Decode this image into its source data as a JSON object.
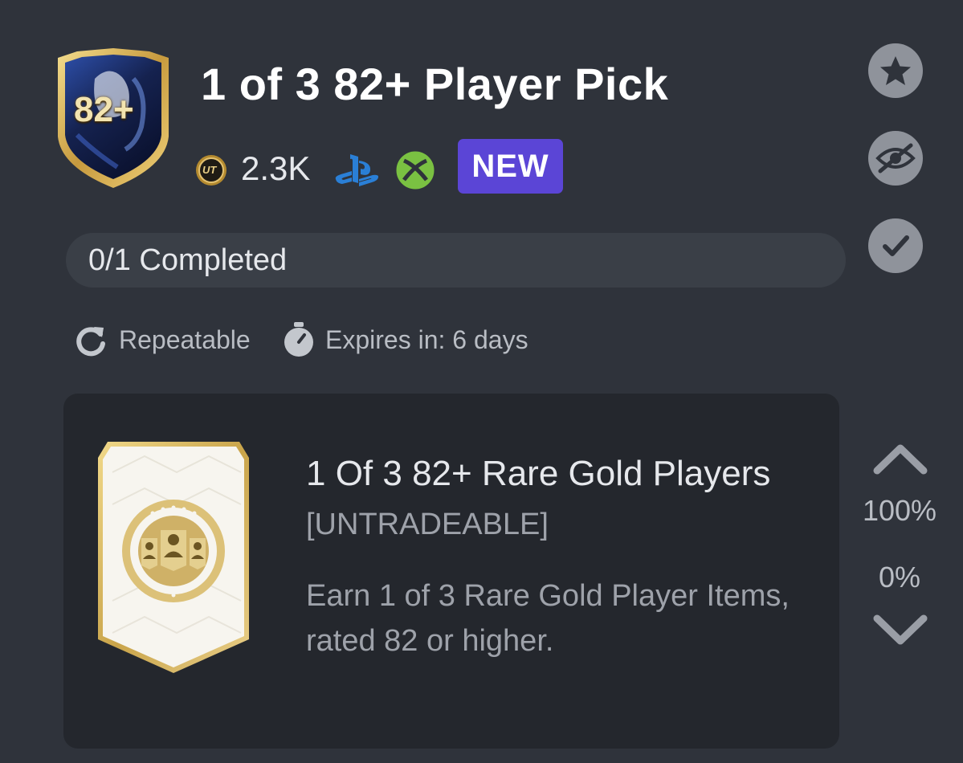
{
  "header": {
    "title": "1 of 3 82+ Player Pick",
    "badge_text": "82+",
    "price": "2.3K",
    "coin_symbol": "UT",
    "new_label": "NEW"
  },
  "progress": {
    "label": "0/1 Completed",
    "fraction": 0
  },
  "meta": {
    "repeatable": "Repeatable",
    "expires": "Expires in: 6 days"
  },
  "reward": {
    "title": "1 Of 3 82+ Rare Gold Players",
    "subtitle": "[UNTRADEABLE]",
    "description": "Earn 1 of 3 Rare Gold Player Items, rated 82 or higher."
  },
  "vote": {
    "up_percent": "100%",
    "down_percent": "0%"
  },
  "icons": [
    "star-icon",
    "hide-eye-icon",
    "check-icon",
    "repeat-icon",
    "stopwatch-icon",
    "coin-icon",
    "playstation-icon",
    "xbox-icon",
    "chevron-up-icon",
    "chevron-down-icon"
  ],
  "colors": {
    "background": "#2f333b",
    "card": "#24272d",
    "new_badge": "#5b45d6",
    "playstation": "#2a7fd6",
    "xbox": "#7ac142",
    "gold": "#c8a24a"
  }
}
